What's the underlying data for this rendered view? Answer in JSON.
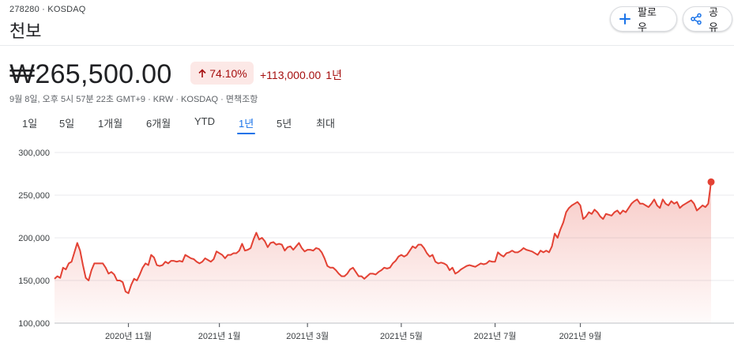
{
  "header": {
    "ticker": "278280 · KOSDAQ",
    "name": "천보",
    "follow_label": "팔로우",
    "share_label": "공유"
  },
  "quote": {
    "price": "₩265,500.00",
    "percent_change": "74.10%",
    "absolute_change": "+113,000.00",
    "period_label": "1년",
    "meta": "9월 8일, 오후 5시 57분 22초 GMT+9 · KRW · KOSDAQ · 면책조항"
  },
  "range_tabs": [
    {
      "label": "1일",
      "active": false
    },
    {
      "label": "5일",
      "active": false
    },
    {
      "label": "1개월",
      "active": false
    },
    {
      "label": "6개월",
      "active": false
    },
    {
      "label": "YTD",
      "active": false
    },
    {
      "label": "1년",
      "active": true
    },
    {
      "label": "5년",
      "active": false
    },
    {
      "label": "최대",
      "active": false
    }
  ],
  "colors": {
    "line": "#e34234",
    "negative_text": "#a50e0e",
    "badge_bg": "#fce8e6",
    "accent": "#1a73e8"
  },
  "icons": {
    "follow": "plus-icon",
    "share": "share-icon",
    "change": "arrow-up-icon"
  },
  "chart_data": {
    "type": "area",
    "ylim": [
      100000,
      300000
    ],
    "y_ticks": [
      100000,
      150000,
      200000,
      250000,
      300000
    ],
    "y_tick_labels": [
      "100,000",
      "150,000",
      "200,000",
      "250,000",
      "300,000"
    ],
    "x_tick_labels": [
      "2020년 11월",
      "2021년 1월",
      "2021년 3월",
      "2021년 5월",
      "2021년 7월",
      "2021년 9월"
    ],
    "x_tick_index": [
      26,
      58,
      89,
      122,
      155,
      185
    ],
    "values": [
      152000,
      155000,
      153000,
      165000,
      163000,
      170000,
      172000,
      183000,
      194000,
      185000,
      168000,
      153000,
      150000,
      162000,
      170000,
      170000,
      170000,
      170000,
      165000,
      158000,
      160000,
      157000,
      150000,
      150000,
      148000,
      137000,
      135000,
      145000,
      152000,
      150000,
      157000,
      165000,
      170000,
      168000,
      180000,
      177000,
      168000,
      167000,
      168000,
      172000,
      170000,
      173000,
      173000,
      172000,
      173000,
      172000,
      180000,
      178000,
      176000,
      175000,
      172000,
      170000,
      172000,
      176000,
      174000,
      172000,
      175000,
      184000,
      182000,
      180000,
      176000,
      180000,
      180000,
      182000,
      182000,
      185000,
      193000,
      185000,
      186000,
      188000,
      198000,
      206000,
      198000,
      200000,
      196000,
      189000,
      194000,
      195000,
      192000,
      193000,
      192000,
      185000,
      189000,
      190000,
      186000,
      190000,
      194000,
      188000,
      184000,
      186000,
      186000,
      185000,
      188000,
      187000,
      183000,
      176000,
      167000,
      165000,
      165000,
      162000,
      158000,
      155000,
      155000,
      158000,
      163000,
      165000,
      160000,
      155000,
      155000,
      152000,
      155000,
      158000,
      158000,
      157000,
      160000,
      162000,
      165000,
      164000,
      165000,
      170000,
      173000,
      178000,
      180000,
      178000,
      180000,
      185000,
      190000,
      188000,
      192000,
      192000,
      188000,
      182000,
      178000,
      180000,
      172000,
      170000,
      171000,
      170000,
      168000,
      162000,
      165000,
      158000,
      160000,
      163000,
      165000,
      167000,
      168000,
      167000,
      166000,
      168000,
      170000,
      169000,
      170000,
      173000,
      172000,
      172000,
      183000,
      180000,
      178000,
      182000,
      183000,
      185000,
      183000,
      183000,
      185000,
      188000,
      186000,
      185000,
      184000,
      182000,
      180000,
      185000,
      183000,
      185000,
      183000,
      190000,
      205000,
      200000,
      210000,
      218000,
      230000,
      235000,
      238000,
      240000,
      242000,
      238000,
      222000,
      225000,
      230000,
      228000,
      233000,
      230000,
      225000,
      222000,
      228000,
      227000,
      226000,
      230000,
      232000,
      228000,
      232000,
      230000,
      235000,
      240000,
      243000,
      245000,
      240000,
      240000,
      238000,
      236000,
      240000,
      245000,
      238000,
      235000,
      245000,
      240000,
      238000,
      243000,
      240000,
      242000,
      235000,
      238000,
      240000,
      242000,
      244000,
      240000,
      232000,
      235000,
      238000,
      236000,
      240000,
      265500
    ]
  }
}
